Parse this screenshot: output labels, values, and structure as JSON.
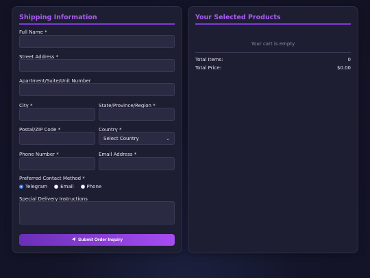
{
  "shipping": {
    "title": "Shipping Information",
    "full_name_label": "Full Name *",
    "full_name_value": "",
    "street_label": "Street Address *",
    "street_value": "",
    "apt_label": "Apartment/Suite/Unit Number",
    "apt_value": "",
    "city_label": "City *",
    "city_value": "",
    "state_label": "State/Province/Region *",
    "state_value": "",
    "zip_label": "Postal/ZIP Code *",
    "zip_value": "",
    "country_label": "Country *",
    "country_selected": "Select Country",
    "phone_label": "Phone Number *",
    "phone_value": "",
    "email_label": "Email Address *",
    "email_value": "",
    "contact_label": "Preferred Contact Method *",
    "contact_options": [
      "Telegram",
      "Email",
      "Phone"
    ],
    "contact_selected": "Telegram",
    "instructions_label": "Special Delivery Instructions",
    "instructions_value": "",
    "submit_label": "Submit Order Inquiry",
    "submit_icon": "paper-plane-icon"
  },
  "products": {
    "title": "Your Selected Products",
    "empty_text": "Your cart is empty",
    "total_items_label": "Total Items:",
    "total_items_value": "0",
    "total_price_label": "Total Price:",
    "total_price_value": "$0.00"
  },
  "colors": {
    "accent": "#a85cf0",
    "button_start": "#6b2fb8",
    "button_end": "#a64cf2",
    "panel_bg": "#1e1e33",
    "page_bg": "#14152a",
    "radio_selected": "#3b82f6"
  }
}
